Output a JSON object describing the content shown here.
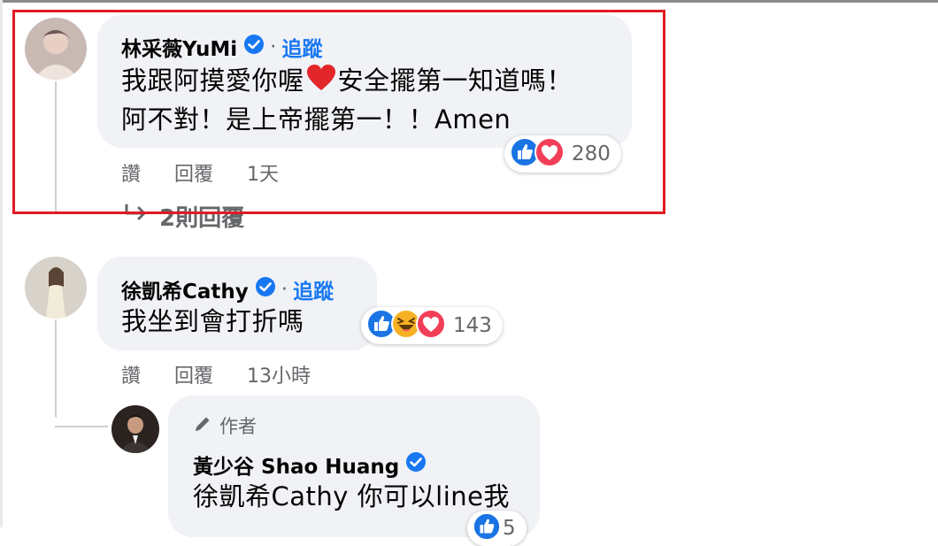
{
  "comments": [
    {
      "author": "林采薇YuMi",
      "follow_label": "追蹤",
      "separator": "·",
      "text_line1_a": "我跟阿摸愛你喔",
      "text_line1_b": "安全擺第一知道嗎！",
      "text_line2": "阿不對！是上帝擺第一！！Amen",
      "actions": {
        "like": "讚",
        "reply": "回覆",
        "time": "1天"
      },
      "reaction_count": "280",
      "reactions": [
        "like-icon",
        "love-icon"
      ],
      "more_replies": "2則回覆"
    },
    {
      "author": "徐凱希Cathy",
      "follow_label": "追蹤",
      "separator": "·",
      "text": "我坐到會打折嗎",
      "actions": {
        "like": "讚",
        "reply": "回覆",
        "time": "13小時"
      },
      "reaction_count": "143",
      "reactions": [
        "like-icon",
        "haha-icon",
        "love-icon"
      ]
    }
  ],
  "reply": {
    "author_badge": "作者",
    "author": "黃少谷 Shao Huang",
    "text": "徐凱希Cathy 你可以line我",
    "reaction_count": "5"
  },
  "colors": {
    "bubble": "#f0f2f5",
    "link": "#1877f2",
    "secondary_text": "#65676b",
    "highlight_border": "#e01b24"
  }
}
